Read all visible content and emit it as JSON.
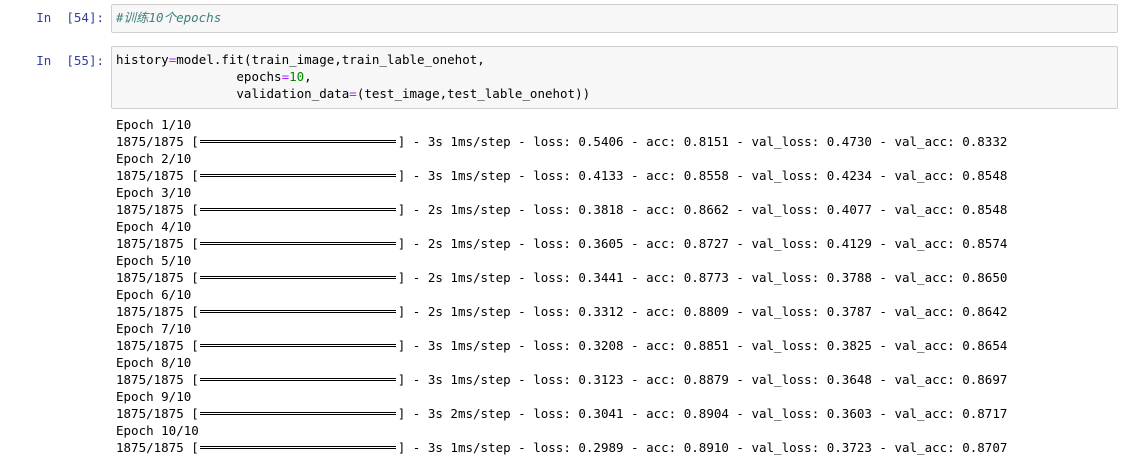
{
  "cells": [
    {
      "prompt": "In  [54]:",
      "code": "#训练10个epochs"
    },
    {
      "prompt": "In  [55]:",
      "code_lines": [
        {
          "a": "history",
          "eq": "=",
          "b": "model.fit(train_image,train_lable_onehot,"
        },
        {
          "a": "                epochs",
          "eq": "=",
          "num": "10",
          "b": ","
        },
        {
          "a": "                validation_data",
          "eq": "=",
          "b": "(test_image,test_lable_onehot))"
        }
      ]
    }
  ],
  "output": {
    "epochs": [
      {
        "label": "Epoch 1/10",
        "progress": "1875/1875",
        "time": "3s 1ms/step",
        "loss": "0.5406",
        "acc": "0.8151",
        "val_loss": "0.4730",
        "val_acc": "0.8332",
        "fraction": 1.0
      },
      {
        "label": "Epoch 2/10",
        "progress": "1875/1875",
        "time": "3s 1ms/step",
        "loss": "0.4133",
        "acc": "0.8558",
        "val_loss": "0.4234",
        "val_acc": "0.8548",
        "fraction": 1.0
      },
      {
        "label": "Epoch 3/10",
        "progress": "1875/1875",
        "time": "2s 1ms/step",
        "loss": "0.3818",
        "acc": "0.8662",
        "val_loss": "0.4077",
        "val_acc": "0.8548",
        "fraction": 1.0
      },
      {
        "label": "Epoch 4/10",
        "progress": "1875/1875",
        "time": "2s 1ms/step",
        "loss": "0.3605",
        "acc": "0.8727",
        "val_loss": "0.4129",
        "val_acc": "0.8574",
        "fraction": 1.0
      },
      {
        "label": "Epoch 5/10",
        "progress": "1875/1875",
        "time": "2s 1ms/step",
        "loss": "0.3441",
        "acc": "0.8773",
        "val_loss": "0.3788",
        "val_acc": "0.8650",
        "fraction": 1.0
      },
      {
        "label": "Epoch 6/10",
        "progress": "1875/1875",
        "time": "2s 1ms/step",
        "loss": "0.3312",
        "acc": "0.8809",
        "val_loss": "0.3787",
        "val_acc": "0.8642",
        "fraction": 1.0
      },
      {
        "label": "Epoch 7/10",
        "progress": "1875/1875",
        "time": "3s 1ms/step",
        "loss": "0.3208",
        "acc": "0.8851",
        "val_loss": "0.3825",
        "val_acc": "0.8654",
        "fraction": 1.0
      },
      {
        "label": "Epoch 8/10",
        "progress": "1875/1875",
        "time": "3s 1ms/step",
        "loss": "0.3123",
        "acc": "0.8879",
        "val_loss": "0.3648",
        "val_acc": "0.8697",
        "fraction": 1.0
      },
      {
        "label": "Epoch 9/10",
        "progress": "1875/1875",
        "time": "3s 2ms/step",
        "loss": "0.3041",
        "acc": "0.8904",
        "val_loss": "0.3603",
        "val_acc": "0.8717",
        "fraction": 1.0
      },
      {
        "label": "Epoch 10/10",
        "progress": "1875/1875",
        "time": "3s 1ms/step",
        "loss": "0.2989",
        "acc": "0.8910",
        "val_loss": "0.3723",
        "val_acc": "0.8707",
        "fraction": 1.0
      }
    ]
  },
  "colors": {
    "prompt": "#303f9f",
    "comment": "#408080",
    "operator": "#aa22ff",
    "number": "#008800",
    "cell_background": "#f7f7f7",
    "cell_border": "#cfcfcf"
  }
}
